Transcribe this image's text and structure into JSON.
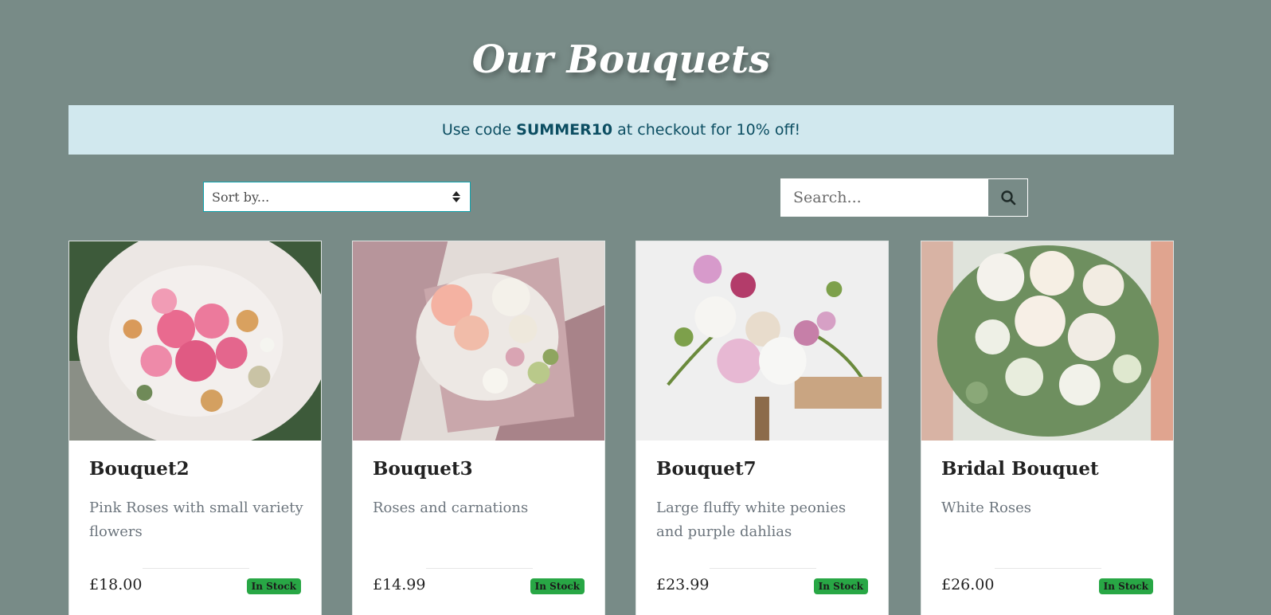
{
  "header": {
    "title": "Our Bouquets"
  },
  "promo": {
    "prefix": "Use code",
    "code": "SUMMER10",
    "suffix": "at checkout for 10% off!"
  },
  "toolbar": {
    "sort_label": "Sort by...",
    "search_placeholder": "Search...",
    "search_icon": "magnifier-icon"
  },
  "colors": {
    "background": "#788b87",
    "promo_bg": "#d1e8ee",
    "promo_text": "#0c4e62",
    "badge_green": "#28a745"
  },
  "products": [
    {
      "name": "Bouquet2",
      "description": "Pink Roses with small variety flowers",
      "price": "£18.00",
      "stock": "In Stock"
    },
    {
      "name": "Bouquet3",
      "description": "Roses and carnations",
      "price": "£14.99",
      "stock": "In Stock"
    },
    {
      "name": "Bouquet7",
      "description": "Large fluffy white peonies and purple dahlias",
      "price": "£23.99",
      "stock": "In Stock"
    },
    {
      "name": "Bridal Bouquet",
      "description": "White Roses",
      "price": "£26.00",
      "stock": "In Stock"
    }
  ]
}
